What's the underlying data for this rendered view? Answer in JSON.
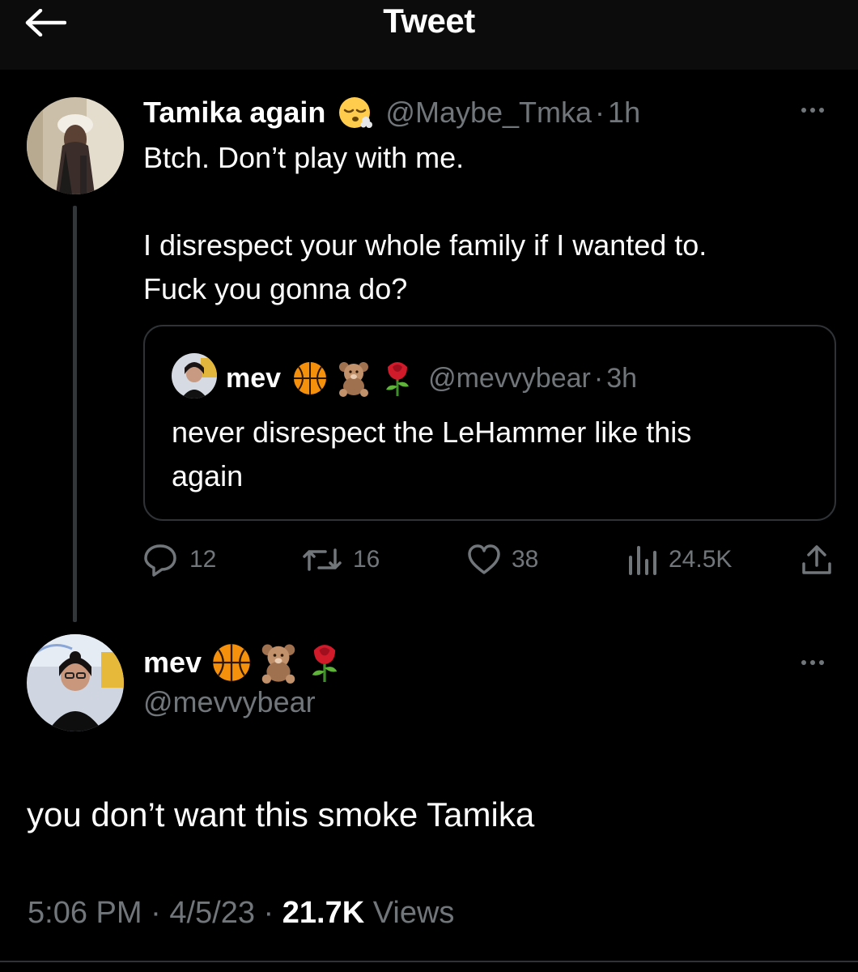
{
  "header": {
    "title": "Tweet",
    "back_icon": "arrow-left-icon"
  },
  "parent_tweet": {
    "display_name": "Tamika again",
    "name_emoji": "face-exhaling-emoji",
    "handle": "@Maybe_Tmka",
    "separator": "·",
    "time": "1h",
    "text": "Btch. Don’t play with me.\n\nI disrespect your whole family if I wanted to.\nFuck you gonna do?",
    "quoted": {
      "display_name": "mev",
      "name_emojis": [
        "basketball-emoji",
        "teddy-bear-emoji",
        "rose-emoji"
      ],
      "handle": "@mevvybear",
      "separator": "·",
      "time": "3h",
      "text": "never disrespect the LeHammer like this\nagain"
    },
    "stats": {
      "replies": "12",
      "retweets": "16",
      "likes": "38",
      "views": "24.5K"
    }
  },
  "reply_tweet": {
    "display_name": "mev",
    "name_emojis": [
      "basketball-emoji",
      "teddy-bear-emoji",
      "rose-emoji"
    ],
    "handle": "@mevvybear",
    "text": "you don’t want this smoke Tamika",
    "time": "5:06 PM",
    "sep1": "·",
    "date": "4/5/23",
    "sep2": "·",
    "views_count": "21.7K",
    "views_label": "Views"
  },
  "colors": {
    "background": "#000000",
    "text": "#e7e9ea",
    "muted": "#71767b",
    "border": "#2f3336"
  }
}
